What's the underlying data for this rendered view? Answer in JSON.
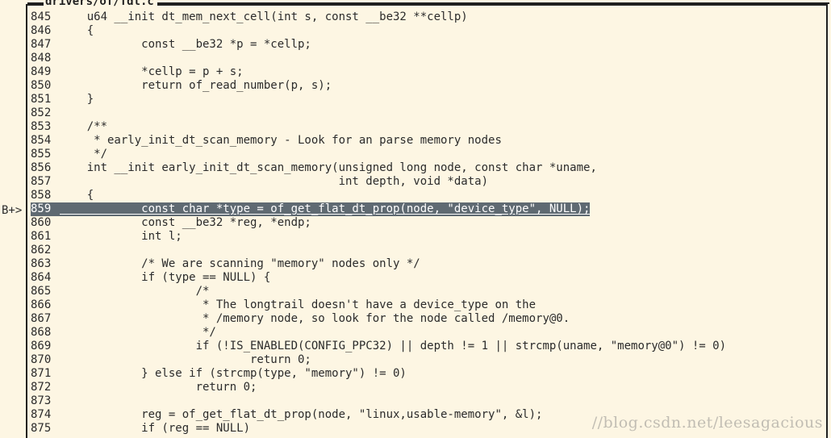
{
  "window": {
    "title": "drivers/of/fdt.c",
    "gutter_marker": "B+>"
  },
  "colors": {
    "background": "#fdf6e3",
    "highlight_bg": "#5f6a72",
    "border": "#1f1f1f"
  },
  "code": {
    "highlight_line": "859",
    "lines": [
      {
        "n": "845",
        "text": "    u64 __init dt_mem_next_cell(int s, const __be32 **cellp)"
      },
      {
        "n": "846",
        "text": "    {"
      },
      {
        "n": "847",
        "text": "            const __be32 *p = *cellp;"
      },
      {
        "n": "848",
        "text": ""
      },
      {
        "n": "849",
        "text": "            *cellp = p + s;"
      },
      {
        "n": "850",
        "text": "            return of_read_number(p, s);"
      },
      {
        "n": "851",
        "text": "    }"
      },
      {
        "n": "852",
        "text": ""
      },
      {
        "n": "853",
        "text": "    /**"
      },
      {
        "n": "854",
        "text": "     * early_init_dt_scan_memory - Look for an parse memory nodes"
      },
      {
        "n": "855",
        "text": "     */"
      },
      {
        "n": "856",
        "text": "    int __init early_init_dt_scan_memory(unsigned long node, const char *uname,"
      },
      {
        "n": "857",
        "text": "                                         int depth, void *data)"
      },
      {
        "n": "858",
        "text": "    {"
      },
      {
        "n": "859",
        "text": "            const char *type = of_get_flat_dt_prop(node, \"device_type\", NULL);"
      },
      {
        "n": "860",
        "text": "            const __be32 *reg, *endp;"
      },
      {
        "n": "861",
        "text": "            int l;"
      },
      {
        "n": "862",
        "text": ""
      },
      {
        "n": "863",
        "text": "            /* We are scanning \"memory\" nodes only */"
      },
      {
        "n": "864",
        "text": "            if (type == NULL) {"
      },
      {
        "n": "865",
        "text": "                    /*"
      },
      {
        "n": "866",
        "text": "                     * The longtrail doesn't have a device_type on the"
      },
      {
        "n": "867",
        "text": "                     * /memory node, so look for the node called /memory@0."
      },
      {
        "n": "868",
        "text": "                     */"
      },
      {
        "n": "869",
        "text": "                    if (!IS_ENABLED(CONFIG_PPC32) || depth != 1 || strcmp(uname, \"memory@0\") != 0)"
      },
      {
        "n": "870",
        "text": "                            return 0;"
      },
      {
        "n": "871",
        "text": "            } else if (strcmp(type, \"memory\") != 0)"
      },
      {
        "n": "872",
        "text": "                    return 0;"
      },
      {
        "n": "873",
        "text": ""
      },
      {
        "n": "874",
        "text": "            reg = of_get_flat_dt_prop(node, \"linux,usable-memory\", &l);"
      },
      {
        "n": "875",
        "text": "            if (reg == NULL)"
      }
    ]
  },
  "watermark": "//blog.csdn.net/leesagacious"
}
